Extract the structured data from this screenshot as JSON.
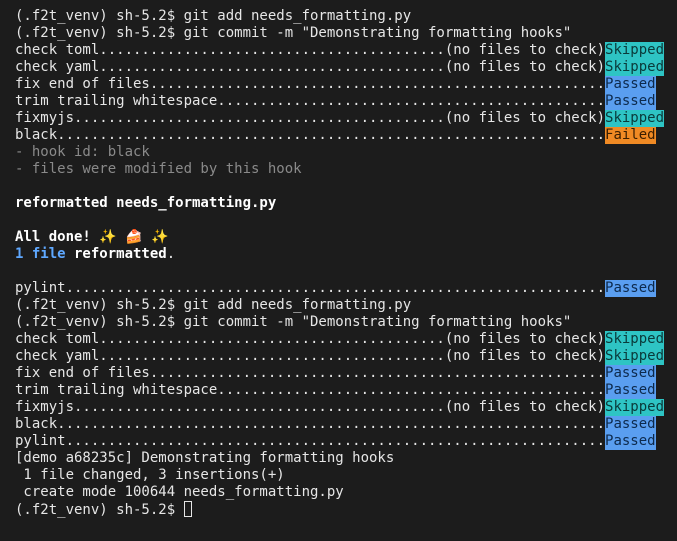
{
  "terminal": {
    "colors": {
      "background": "#1c1c1c",
      "text": "#e6e6e6",
      "skipped": "#2ec4c4",
      "passed": "#5a9ef0",
      "failed": "#f08a24"
    },
    "lines": [
      {
        "text": "(.f2t_venv) sh-5.2$ git add needs_formatting.py"
      },
      {
        "text": "(.f2t_venv) sh-5.2$ git commit -m \"Demonstrating formatting hooks\""
      },
      {
        "text": "check toml.........................................(no files to check)",
        "badge": "Skipped",
        "status": "skipped"
      },
      {
        "text": "check yaml.........................................(no files to check)",
        "badge": "Skipped",
        "status": "skipped"
      },
      {
        "text": "fix end of files......................................................",
        "badge": "Passed",
        "status": "passed"
      },
      {
        "text": "trim trailing whitespace..............................................",
        "badge": "Passed",
        "status": "passed"
      },
      {
        "text": "fixmyjs............................................(no files to check)",
        "badge": "Skipped",
        "status": "skipped"
      },
      {
        "text": "black.................................................................",
        "badge": "Failed",
        "status": "failed"
      },
      {
        "text": "- hook id: black",
        "style": "muted"
      },
      {
        "text": "- files were modified by this hook",
        "style": "muted"
      },
      {
        "text": ""
      },
      {
        "text": "reformatted needs_formatting.py",
        "style": "bold"
      },
      {
        "text": ""
      },
      {
        "text": "All done! ✨ 🍰 ✨",
        "style": "bold"
      },
      {
        "segments": [
          {
            "text": "1 file",
            "style": "blue-bold"
          },
          {
            "text": " reformatted",
            "style": "bold"
          },
          {
            "text": "."
          }
        ]
      },
      {
        "text": ""
      },
      {
        "text": "pylint................................................................",
        "badge": "Passed",
        "status": "passed"
      },
      {
        "text": "(.f2t_venv) sh-5.2$ git add needs_formatting.py"
      },
      {
        "text": "(.f2t_venv) sh-5.2$ git commit -m \"Demonstrating formatting hooks\""
      },
      {
        "text": "check toml.........................................(no files to check)",
        "badge": "Skipped",
        "status": "skipped"
      },
      {
        "text": "check yaml.........................................(no files to check)",
        "badge": "Skipped",
        "status": "skipped"
      },
      {
        "text": "fix end of files......................................................",
        "badge": "Passed",
        "status": "passed"
      },
      {
        "text": "trim trailing whitespace..............................................",
        "badge": "Passed",
        "status": "passed"
      },
      {
        "text": "fixmyjs............................................(no files to check)",
        "badge": "Skipped",
        "status": "skipped"
      },
      {
        "text": "black.................................................................",
        "badge": "Passed",
        "status": "passed"
      },
      {
        "text": "pylint................................................................",
        "badge": "Passed",
        "status": "passed"
      },
      {
        "text": "[demo a68235c] Demonstrating formatting hooks"
      },
      {
        "text": " 1 file changed, 3 insertions(+)"
      },
      {
        "text": " create mode 100644 needs_formatting.py"
      },
      {
        "text": "(.f2t_venv) sh-5.2$ ",
        "cursor": true
      }
    ]
  }
}
